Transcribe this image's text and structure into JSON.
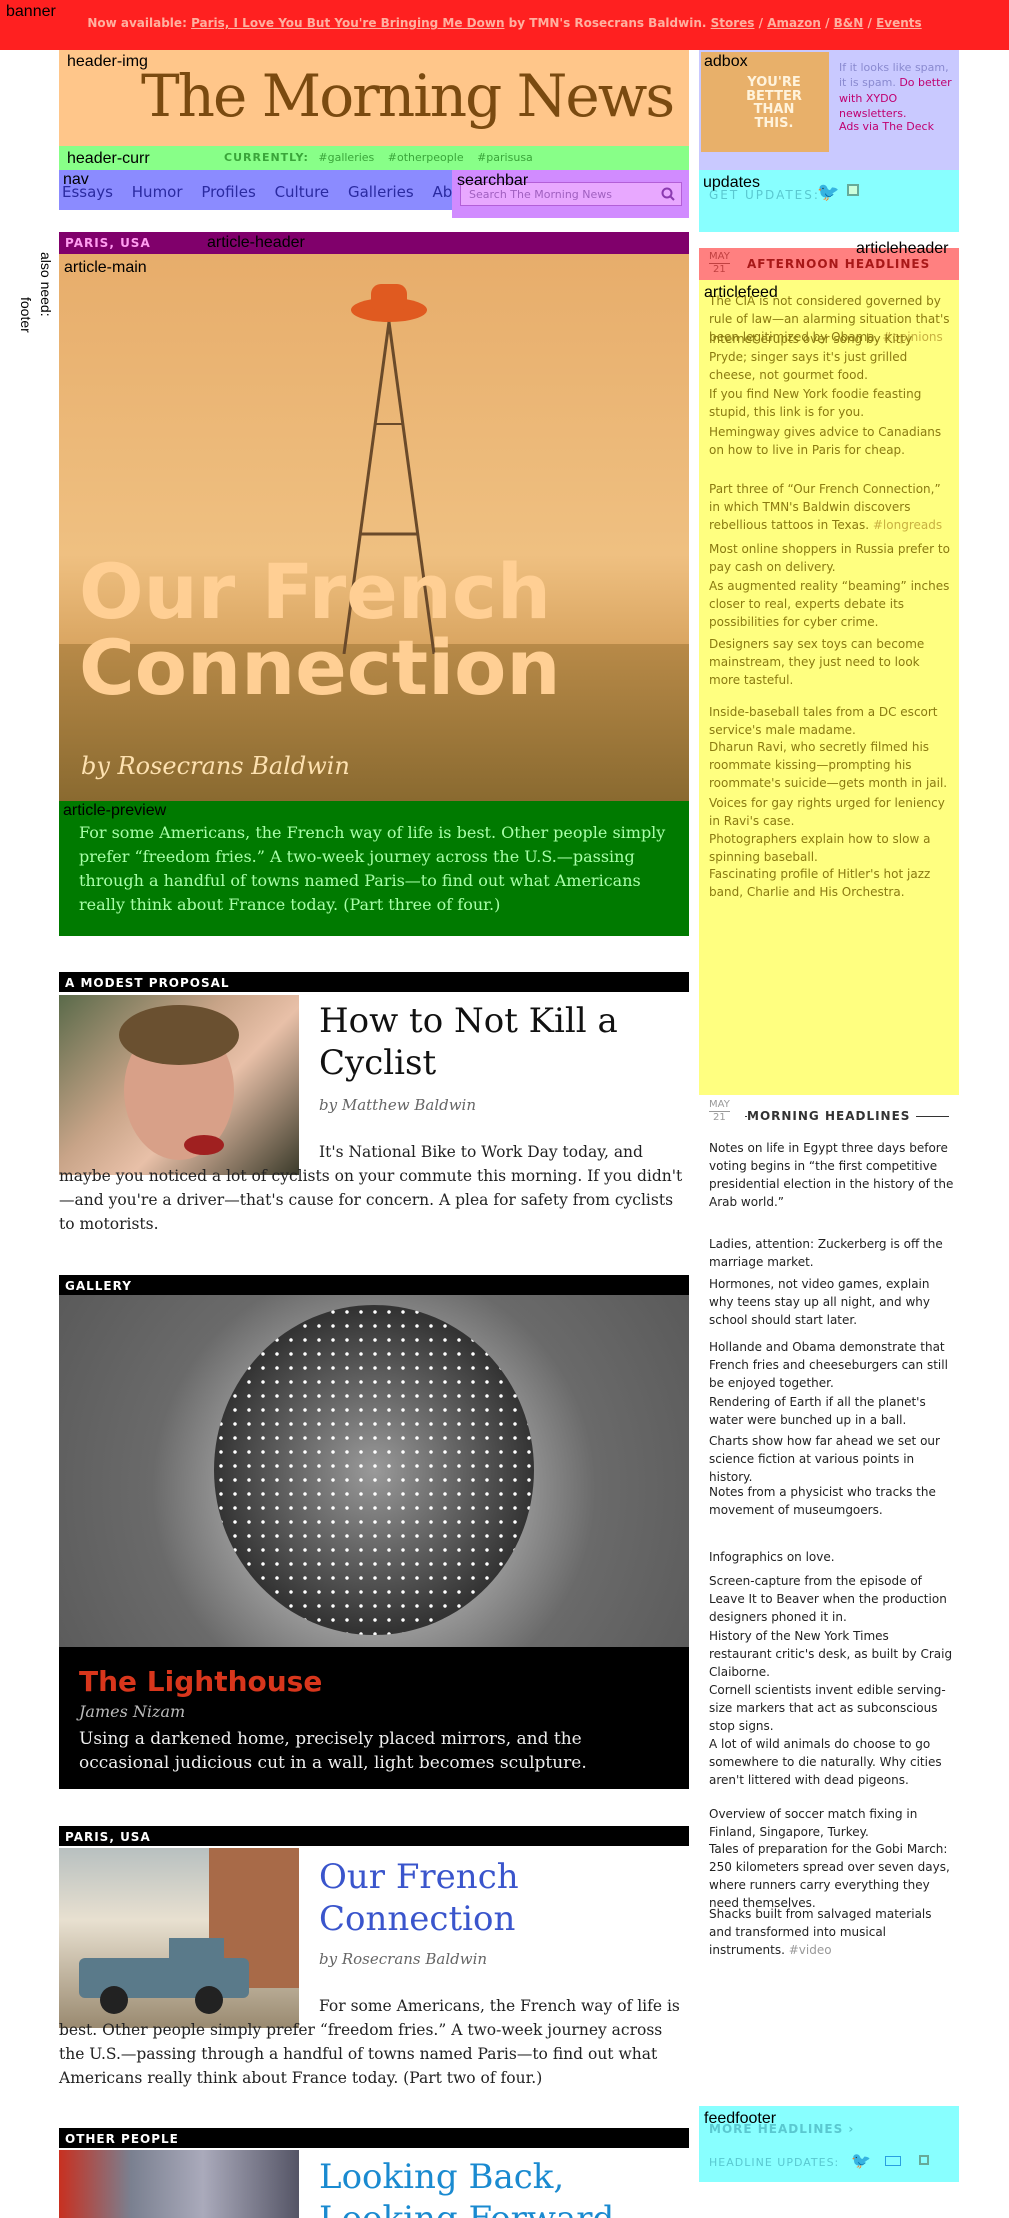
{
  "labels": {
    "banner": "banner",
    "header_img": "header-img",
    "header_curr": "header-curr",
    "nav": "nav",
    "searchbar": "searchbar",
    "adbox": "adbox",
    "updates": "updates",
    "article_header": "article-header",
    "article_main": "article-main",
    "article_preview": "article-preview",
    "articleheader": "articleheader",
    "articlefeed": "articlefeed",
    "feedfooter": "feedfooter",
    "also_need": "also need:",
    "footer": "footer"
  },
  "banner": {
    "prefix": "Now available:",
    "book": "Paris, I Love You But You're Bringing Me Down",
    "by": "by TMN's Rosecrans Baldwin.",
    "links": [
      "Stores",
      "Amazon",
      "B&N",
      "Events"
    ],
    "sep": "/"
  },
  "header": {
    "logo": "The Morning News",
    "currently_label": "CURRENTLY:",
    "currently_tags": [
      "#galleries",
      "#otherpeople",
      "#parisusa"
    ]
  },
  "nav": {
    "items": [
      "Essays",
      "Humor",
      "Profiles",
      "Culture",
      "Galleries",
      "About"
    ]
  },
  "search": {
    "placeholder": "Search The Morning News"
  },
  "ad": {
    "image_text": "YOU'RE BETTER THAN THIS.",
    "text_plain": "If it looks like spam, it is spam.",
    "text_link": "Do better with XYDO newsletters.",
    "via": "Ads via The Deck"
  },
  "updates": {
    "label": "GET UPDATES:"
  },
  "feature": {
    "kicker": "PARIS, USA",
    "title_line1": "Our French",
    "title_line2": "Connection",
    "byline": "by Rosecrans Baldwin",
    "preview": "For some Americans, the French way of life is best. Other people simply prefer “freedom fries.” A two-week journey across the U.S.—passing through a handful of towns named Paris—to find out what Americans really think about France today. (Part three of four.)"
  },
  "afternoon": {
    "month": "MAY",
    "day": "21",
    "title": "AFTERNOON HEADLINES",
    "items": [
      {
        "text": "The CIA is not considered governed by rule of law—an alarming situation that's been legitimized by Obama.",
        "tag": "#opinions"
      },
      {
        "text": "Internet erupts over song by Kitty Pryde; singer says it's just grilled cheese, not gourmet food.",
        "tag": ""
      },
      {
        "text": "If you find New York foodie feasting stupid, this link is for you.",
        "tag": ""
      },
      {
        "text": "Hemingway gives advice to Canadians on how to live in Paris for cheap.",
        "tag": ""
      },
      {
        "text": "Part three of “Our French Connection,” in which TMN's Baldwin discovers rebellious tattoos in Texas.",
        "tag": "#longreads"
      },
      {
        "text": "Most online shoppers in Russia prefer to pay cash on delivery.",
        "tag": ""
      },
      {
        "text": "As augmented reality “beaming” inches closer to real, experts debate its possibilities for cyber crime.",
        "tag": ""
      },
      {
        "text": "Designers say sex toys can become mainstream, they just need to look more tasteful.",
        "tag": ""
      },
      {
        "text": "Inside-baseball tales from a DC escort service's male madame.",
        "tag": ""
      },
      {
        "text": "Dharun Ravi, who secretly filmed his roommate kissing—prompting his roommate's suicide—gets month in jail.",
        "tag": ""
      },
      {
        "text": "Voices for gay rights urged for leniency in Ravi's case.",
        "tag": ""
      },
      {
        "text": "Photographers explain how to slow a spinning baseball.",
        "tag": ""
      },
      {
        "text": "Fascinating profile of Hitler's hot jazz band, Charlie and His Orchestra.",
        "tag": ""
      }
    ]
  },
  "morning": {
    "month": "MAY",
    "day": "21",
    "title": "MORNING HEADLINES",
    "items": [
      {
        "text": "Notes on life in Egypt three days before voting begins in “the first competitive presidential election in the history of the Arab world.”",
        "tag": ""
      },
      {
        "text": "Ladies, attention: Zuckerberg is off the marriage market.",
        "tag": ""
      },
      {
        "text": "Hormones, not video games, explain why teens stay up all night, and why school should start later.",
        "tag": ""
      },
      {
        "text": "Hollande and Obama demonstrate that French fries and cheeseburgers can still be enjoyed together.",
        "tag": ""
      },
      {
        "text": "Rendering of Earth if all the planet's water were bunched up in a ball.",
        "tag": ""
      },
      {
        "text": "Charts show how far ahead we set our science fiction at various points in history.",
        "tag": ""
      },
      {
        "text": "Notes from a physicist who tracks the movement of museumgoers.",
        "tag": ""
      },
      {
        "text": "Infographics on love.",
        "tag": ""
      },
      {
        "text": "Screen-capture from the episode of Leave It to Beaver when the production designers phoned it in.",
        "tag": ""
      },
      {
        "text": "History of the New York Times restaurant critic's desk, as built by Craig Claiborne.",
        "tag": ""
      },
      {
        "text": "Cornell scientists invent edible serving-size markers that act as subconscious stop signs.",
        "tag": ""
      },
      {
        "text": "A lot of wild animals do choose to go somewhere to die naturally. Why cities aren't littered with dead pigeons.",
        "tag": ""
      },
      {
        "text": "Overview of soccer match fixing in Finland, Singapore, Turkey.",
        "tag": ""
      },
      {
        "text": "Tales of preparation for the Gobi March: 250 kilometers spread over seven days, where runners carry everything they need themselves.",
        "tag": ""
      },
      {
        "text": "Shacks built from salvaged materials and transformed into musical instruments.",
        "tag": "#video"
      }
    ]
  },
  "feedfooter": {
    "more": "MORE HEADLINES ›",
    "headline_updates": "HEADLINE UPDATES:"
  },
  "stories": {
    "cyclist": {
      "kicker": "A MODEST PROPOSAL",
      "title": "How to Not Kill a Cyclist",
      "byline": "by Matthew Baldwin",
      "body": "It's National Bike to Work Day today, and maybe you noticed a lot of cyclists on your commute this morning. If you didn't—and you're a driver—that's cause for concern. A plea for safety from cyclists to motorists."
    },
    "gallery": {
      "kicker": "GALLERY",
      "title": "The Lighthouse",
      "author": "James Nizam",
      "desc": "Using a darkened home, precisely placed mirrors, and the occasional judicious cut in a wall, light becomes sculpture."
    },
    "paris": {
      "kicker": "PARIS, USA",
      "title": "Our French Connection",
      "byline": "by Rosecrans Baldwin",
      "body": "For some Americans, the French way of life is best. Other people simply prefer “freedom fries.” A two-week journey across the U.S.—passing through a handful of towns named Paris—to find out what Americans really think about France today. (Part two of four.)"
    },
    "other": {
      "kicker": "OTHER PEOPLE",
      "title": "Looking Back, Looking Forward"
    }
  },
  "colors": {
    "banner": "#ff2020",
    "header_img": "#ffc68a",
    "header_curr": "#88ff88",
    "nav": "#8b8bff",
    "searchbar": "#d18bff",
    "adbox": "#c9c9ff",
    "updates": "#88ffff",
    "article_header": "#80006b",
    "article_preview": "#007a00",
    "articleheader": "#ff8080",
    "articlefeed": "#ffff80",
    "story_link": "#3a55cc"
  }
}
